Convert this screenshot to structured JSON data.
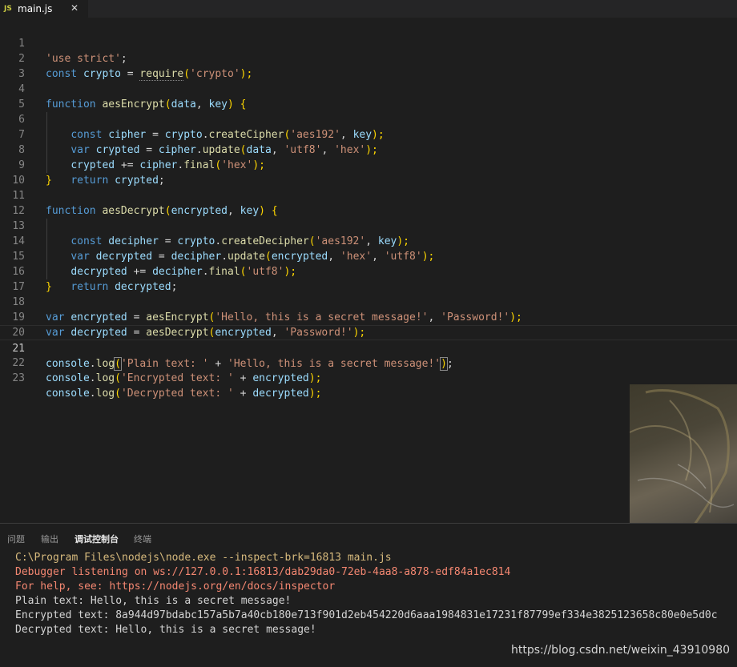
{
  "tab": {
    "icon": "JS",
    "name": "main.js",
    "close": "✕"
  },
  "code_lines": [
    {
      "n": "1"
    },
    {
      "n": "2"
    },
    {
      "n": "3"
    },
    {
      "n": "4"
    },
    {
      "n": "5"
    },
    {
      "n": "6"
    },
    {
      "n": "7"
    },
    {
      "n": "8"
    },
    {
      "n": "9"
    },
    {
      "n": "10"
    },
    {
      "n": "11"
    },
    {
      "n": "12"
    },
    {
      "n": "13"
    },
    {
      "n": "14"
    },
    {
      "n": "15"
    },
    {
      "n": "16"
    },
    {
      "n": "17"
    },
    {
      "n": "18"
    },
    {
      "n": "19"
    },
    {
      "n": "20"
    },
    {
      "n": "21"
    },
    {
      "n": "22"
    },
    {
      "n": "23"
    }
  ],
  "code": {
    "l1": [
      "'use strict'",
      ";"
    ],
    "l2": [
      "const",
      "crypto",
      "=",
      "require",
      "(",
      "'crypto'",
      ");"
    ],
    "l4": [
      "function",
      "aesEncrypt",
      "(",
      "data",
      ", ",
      "key",
      ") ",
      "{"
    ],
    "l5": [
      "const",
      "cipher",
      "=",
      "crypto",
      ".",
      "createCipher",
      "(",
      "'aes192'",
      ", ",
      "key",
      ");"
    ],
    "l6": [
      "var",
      "crypted",
      "=",
      "cipher",
      ".",
      "update",
      "(",
      "data",
      ", ",
      "'utf8'",
      ", ",
      "'hex'",
      ");"
    ],
    "l7": [
      "crypted",
      "+=",
      "cipher",
      ".",
      "final",
      "(",
      "'hex'",
      ");"
    ],
    "l8": [
      "return",
      "crypted",
      ";"
    ],
    "l9": [
      "}"
    ],
    "l11": [
      "function",
      "aesDecrypt",
      "(",
      "encrypted",
      ", ",
      "key",
      ") ",
      "{"
    ],
    "l12": [
      "const",
      "decipher",
      "=",
      "crypto",
      ".",
      "createDecipher",
      "(",
      "'aes192'",
      ", ",
      "key",
      ");"
    ],
    "l13": [
      "var",
      "decrypted",
      "=",
      "decipher",
      ".",
      "update",
      "(",
      "encrypted",
      ", ",
      "'hex'",
      ", ",
      "'utf8'",
      ");"
    ],
    "l14": [
      "decrypted",
      "+=",
      "decipher",
      ".",
      "final",
      "(",
      "'utf8'",
      ");"
    ],
    "l15": [
      "return",
      "decrypted",
      ";"
    ],
    "l16": [
      "}"
    ],
    "l18": [
      "var",
      "encrypted",
      "=",
      "aesEncrypt",
      "(",
      "'Hello, this is a secret message!'",
      ", ",
      "'Password!'",
      ");"
    ],
    "l19": [
      "var",
      "decrypted",
      "=",
      "aesDecrypt",
      "(",
      "encrypted",
      ", ",
      "'Password!'",
      ");"
    ],
    "l21": [
      "console",
      ".",
      "log",
      "(",
      "'Plain text: '",
      " + ",
      "'Hello, this is a secret message!'",
      ")",
      ";"
    ],
    "l22": [
      "console",
      ".",
      "log",
      "(",
      "'Encrypted text: '",
      " + ",
      "encrypted",
      ");"
    ],
    "l23": [
      "console",
      ".",
      "log",
      "(",
      "'Decrypted text: '",
      " + ",
      "decrypted",
      ");"
    ]
  },
  "panel": {
    "tabs": [
      "问题",
      "输出",
      "调试控制台",
      "终端"
    ],
    "active_tab": "调试控制台",
    "output": [
      "C:\\Program Files\\nodejs\\node.exe --inspect-brk=16813 main.js",
      "Debugger listening on ws://127.0.0.1:16813/dab29da0-72eb-4aa8-a878-edf84a1ec814",
      "For help, see: https://nodejs.org/en/docs/inspector",
      "Plain text: Hello, this is a secret message!",
      "Encrypted text: 8a944d97bdabc157a5b7a40cb180e713f901d2eb454220d6aaa1984831e17231f87799ef334e3825123658c80e0e5d0c",
      "Decrypted text: Hello, this is a secret message!"
    ]
  },
  "watermark": "https://blog.csdn.net/weixin_43910980",
  "colors": {
    "keyword": "#569cd6",
    "function": "#dcdcaa",
    "variable": "#9cdcfe",
    "string": "#ce9178",
    "bracket": "#ffd700",
    "background": "#1e1e1e"
  }
}
